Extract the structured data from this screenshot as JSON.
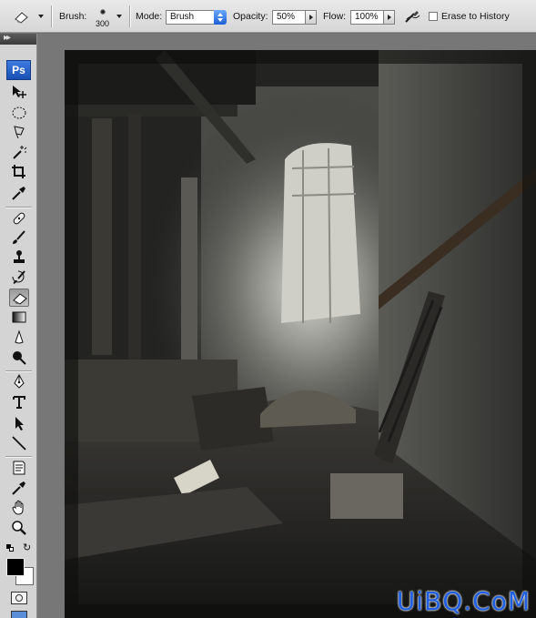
{
  "options_bar": {
    "brush_label": "Brush:",
    "brush_size": "300",
    "mode_label": "Mode:",
    "mode_value": "Brush",
    "opacity_label": "Opacity:",
    "opacity_value": "50%",
    "flow_label": "Flow:",
    "flow_value": "100%",
    "airbrush_icon": "airbrush-icon",
    "erase_history_label": "Erase to History",
    "erase_history_checked": false,
    "tool_preset_icon": "eraser-icon"
  },
  "toolbox": {
    "logo": "Ps",
    "tools": [
      "move-icon",
      "marquee-icon",
      "lasso-icon",
      "magic-wand-icon",
      "crop-icon",
      "eyedropper-icon",
      "healing-brush-icon",
      "brush-icon",
      "clone-stamp-icon",
      "history-brush-icon",
      "eraser-icon",
      "gradient-icon",
      "blur-icon",
      "dodge-icon",
      "pen-icon",
      "type-icon",
      "path-selection-icon",
      "line-icon",
      "notes-icon",
      "eyedropper-icon",
      "hand-icon",
      "zoom-icon"
    ],
    "active_tool": "eraser-icon",
    "foreground_color": "#000000",
    "background_color": "#ffffff"
  },
  "canvas": {
    "watermark": "UiBQ.CoM"
  }
}
